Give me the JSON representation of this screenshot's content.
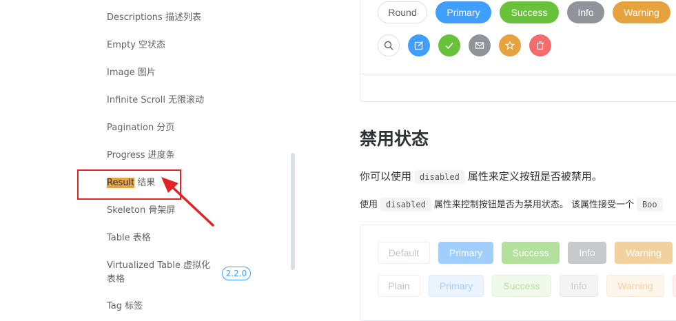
{
  "sidebar": {
    "items": [
      {
        "label": "Descriptions 描述列表"
      },
      {
        "label": "Empty 空状态"
      },
      {
        "label": "Image 图片"
      },
      {
        "label": "Infinite Scroll 无限滚动"
      },
      {
        "label": "Pagination 分页"
      },
      {
        "label": "Progress 进度条"
      },
      {
        "label_highlight": "Result",
        "label_rest": " 结果"
      },
      {
        "label": "Skeleton 骨架屏"
      },
      {
        "label": "Table 表格"
      },
      {
        "label": "Virtualized Table 虚拟化表格",
        "badge": "2.2.0"
      },
      {
        "label": "Tag 标签"
      }
    ]
  },
  "demo_round": {
    "buttons": [
      "Round",
      "Primary",
      "Success",
      "Info",
      "Warning"
    ],
    "circle_icons": [
      "search-icon",
      "edit-icon",
      "check-icon",
      "message-icon",
      "star-icon",
      "delete-icon"
    ]
  },
  "section": {
    "heading": "禁用状态",
    "para1_before": "你可以使用",
    "para1_code": "disabled",
    "para1_after": "属性来定义按钮是否被禁用。",
    "para2_before": "使用",
    "para2_code": "disabled",
    "para2_after": "属性来控制按钮是否为禁用状态。 该属性接受一个",
    "para2_code2": "Boo"
  },
  "demo_disabled": {
    "row1": [
      "Default",
      "Primary",
      "Success",
      "Info",
      "Warning"
    ],
    "row2": [
      "Plain",
      "Primary",
      "Success",
      "Info",
      "Warning"
    ]
  },
  "colors": {
    "primary": "#409eff",
    "success": "#67c23a",
    "info": "#909399",
    "warning": "#e6a23c",
    "danger": "#f56c6c",
    "callout": "#e02424"
  }
}
